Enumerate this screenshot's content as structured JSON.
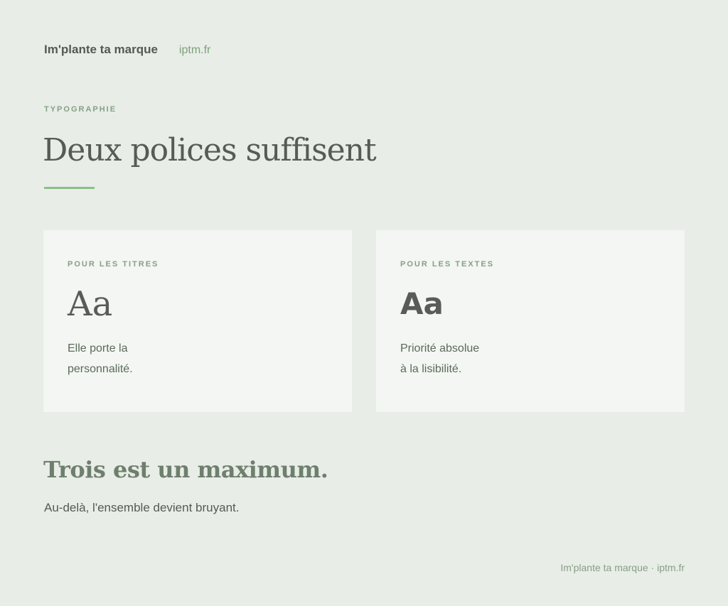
{
  "header": {
    "brand": "Im'plante ta marque",
    "site": "iptm.fr"
  },
  "section": {
    "eyebrow": "TYPOGRAPHIE",
    "title": "Deux polices suffisent"
  },
  "cards": [
    {
      "label": "POUR LES TITRES",
      "sample": "Aa",
      "desc_line1": "Elle porte la",
      "desc_line2": "personnalité."
    },
    {
      "label": "POUR LES TEXTES",
      "sample": "Aa",
      "desc_line1": "Priorité absolue",
      "desc_line2": "à la lisibilité."
    }
  ],
  "closing": {
    "headline": "Trois est un maximum.",
    "text": "Au-delà, l'ensemble devient bruyant."
  },
  "footer": {
    "text": "Im'plante ta marque · iptm.fr"
  },
  "colors": {
    "background": "#e8ede7",
    "card": "#f3f6f2",
    "accent": "#8cbf8a",
    "muted_green": "#87a085",
    "text": "#585c57"
  }
}
